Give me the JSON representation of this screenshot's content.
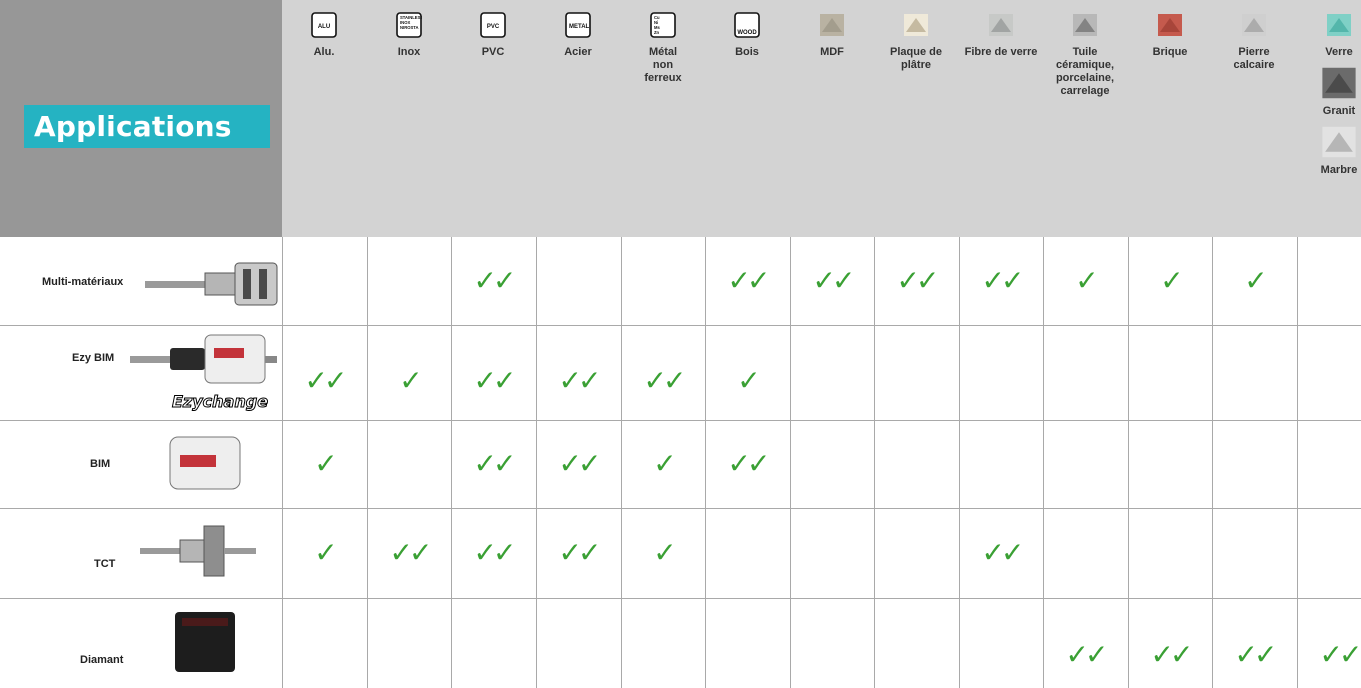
{
  "header_label": "Applications",
  "colors": {
    "check": "#3aa034",
    "label_bg": "#25b3c2",
    "header_bg": "#d3d3d3",
    "corner_bg": "#979797"
  },
  "materials": [
    {
      "label": "Alu.",
      "icon": "aluminium-icon",
      "icon_text": "ALU"
    },
    {
      "label": "Inox",
      "icon": "stainless-steel-icon",
      "icon_text": "STAINLESS\nINOX\nNIROSTA"
    },
    {
      "label": "PVC",
      "icon": "pvc-icon",
      "icon_text": "PVC"
    },
    {
      "label": "Acier",
      "icon": "steel-icon",
      "icon_text": "METAL"
    },
    {
      "label": "Métal\nnon\nferreux",
      "icon": "non-ferrous-metal-icon",
      "icon_text": "Cu\nNi\nMs\nZn"
    },
    {
      "label": "Bois",
      "icon": "wood-icon",
      "icon_text": "WOOD"
    },
    {
      "label": "MDF",
      "icon": "mdf-icon",
      "icon_text": ""
    },
    {
      "label": "Plaque de\nplâtre",
      "icon": "plasterboard-icon",
      "icon_text": ""
    },
    {
      "label": "Fibre de verre",
      "icon": "fiberglass-icon",
      "icon_text": ""
    },
    {
      "label": "Tuile\ncéramique,\nporcelaine,\ncarrelage",
      "icon": "ceramic-tile-icon",
      "icon_text": ""
    },
    {
      "label": "Brique",
      "icon": "brick-icon",
      "icon_text": ""
    },
    {
      "label": "Pierre\ncalcaire",
      "icon": "limestone-icon",
      "icon_text": ""
    },
    {
      "label": "Verre",
      "icon": "glass-icon",
      "icon_text": "",
      "extra": [
        {
          "label": "Granit",
          "icon": "granite-icon"
        },
        {
          "label": "Marbre",
          "icon": "marble-icon"
        }
      ]
    }
  ],
  "tools": [
    {
      "label": "Multi-matériaux",
      "icon": "multi-material-holesaw-icon",
      "ratings": [
        0,
        0,
        2,
        0,
        0,
        2,
        2,
        2,
        2,
        1,
        1,
        1,
        0
      ]
    },
    {
      "label": "Ezy BIM",
      "icon": "ezy-bim-holesaw-icon",
      "brand": "Ezychange",
      "ratings": [
        2,
        1,
        2,
        2,
        2,
        1,
        0,
        0,
        0,
        0,
        0,
        0,
        0
      ]
    },
    {
      "label": "BIM",
      "icon": "bim-holesaw-icon",
      "ratings": [
        1,
        0,
        2,
        2,
        1,
        2,
        0,
        0,
        0,
        0,
        0,
        0,
        0
      ]
    },
    {
      "label": "TCT",
      "icon": "tct-holesaw-icon",
      "ratings": [
        1,
        2,
        2,
        2,
        1,
        0,
        0,
        0,
        2,
        0,
        0,
        0,
        0
      ]
    },
    {
      "label": "Diamant",
      "icon": "diamond-holesaw-icon",
      "ratings": [
        0,
        0,
        0,
        0,
        0,
        0,
        0,
        0,
        0,
        2,
        2,
        2,
        2
      ]
    }
  ],
  "check_glyphs": {
    "1": "✓",
    "2": "✓✓"
  }
}
